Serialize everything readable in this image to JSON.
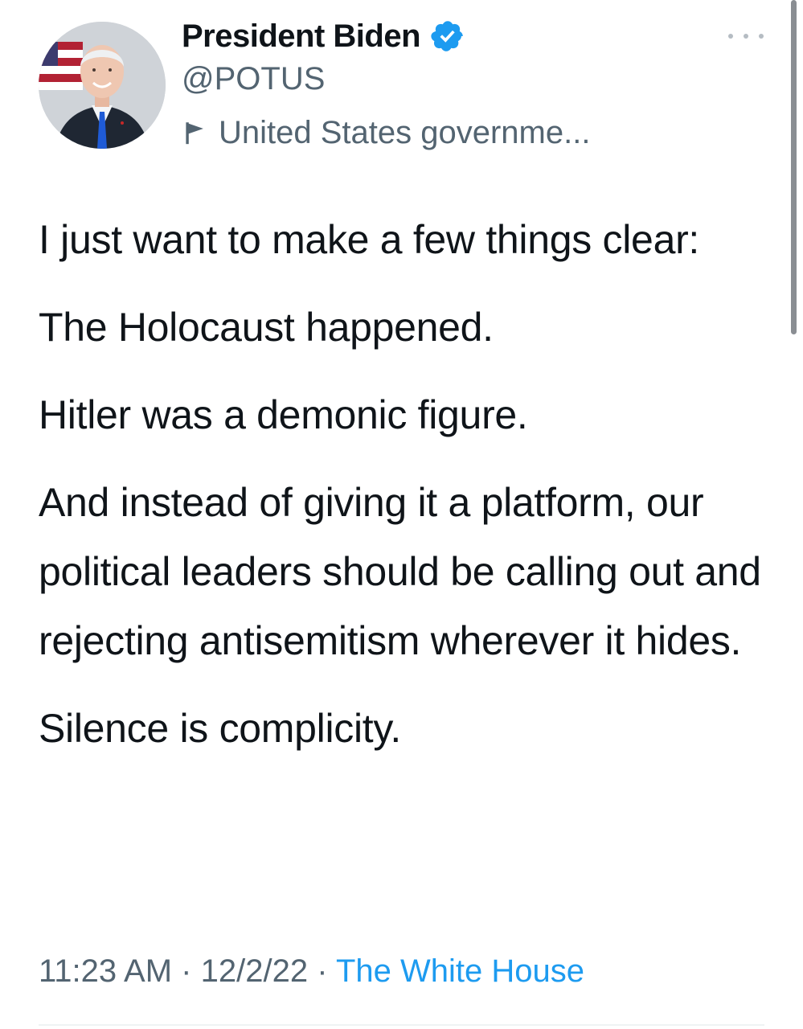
{
  "tweet": {
    "author": {
      "display_name": "President Biden",
      "handle": "@POTUS",
      "verified": true,
      "label": "United States governme...",
      "label_icon": "flag-icon",
      "avatar": "avatar-portrait"
    },
    "more_menu_icon": "more-icon",
    "paragraphs": [
      "I just want to make a few things clear:",
      "The Holocaust happened.",
      "Hitler was a demonic figure.",
      "And instead of giving it a platform, our political leaders should be calling out and rejecting antisemitism wherever it hides.",
      "Silence is complicity."
    ],
    "meta": {
      "time": "11:23 AM",
      "separator": "·",
      "date": "12/2/22",
      "source": "The White House"
    }
  },
  "colors": {
    "text_primary": "#0f1419",
    "text_secondary": "#536471",
    "link": "#1d9bf0",
    "verified_badge": "#1d9bf0"
  }
}
